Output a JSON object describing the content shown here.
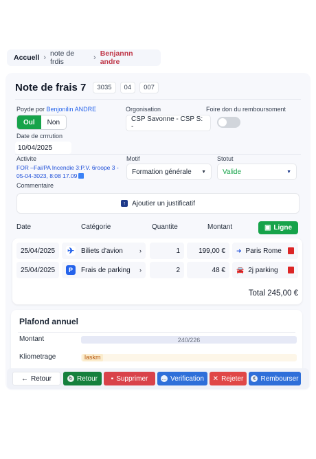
{
  "breadcrumb": {
    "home": "Accuell",
    "parent": "note de frdis",
    "current": "Benjannn andre",
    "separator": "›"
  },
  "header": {
    "title": "Note de frais 7",
    "chips": [
      "3035",
      "04",
      "007"
    ]
  },
  "form": {
    "paid_by": {
      "label_prefix": "Poyde por ",
      "label_name": "Benjonilin ANDRE",
      "yes": "Oul",
      "no": "Non"
    },
    "organisation": {
      "label": "Orgonisation",
      "value": "CSP Savonne - CSP S: -"
    },
    "refund": {
      "label": "Foire don du remboursoment"
    },
    "creation_date": {
      "label": "Date de crrrution",
      "value": "10/04/2025"
    },
    "activity": {
      "label": "Activite",
      "line1": "FOR –Fai/PA  Incendie 3:P.V. 6roope 3 -",
      "line2": "05-04-3023, 8:08 17.09"
    },
    "motif": {
      "label": "Motif",
      "value": "Formation générale"
    },
    "status": {
      "label": "Stotut",
      "value": "Valide"
    },
    "comment": {
      "label": "Commentaire"
    },
    "attach_label": "Ajoutier un justificatif"
  },
  "table": {
    "headers": {
      "date": "Date",
      "category": "Catégorie",
      "quantity": "Quantite",
      "amount": "Montant"
    },
    "add_label": "Ligne",
    "rows": [
      {
        "date": "25/04/2025",
        "category": "Biliets d'avion",
        "quantity": "1",
        "amount": "199,00 €",
        "detail": "Paris Rome",
        "detail_icon": "arrow-right-icon"
      },
      {
        "date": "25/04/2025",
        "category": "Frais de parking",
        "quantity": "2",
        "amount": "48 €",
        "detail": "2j parking",
        "detail_icon": "car-icon"
      }
    ],
    "total": "Total 245,00 €"
  },
  "plafond": {
    "title": "Plafond annuel",
    "amount_label": "Montant",
    "amount_value": "240/226",
    "km_label": "Kliometrage",
    "km_value": "laskm"
  },
  "actions": {
    "back": "Retour",
    "return": "Retour",
    "delete": "Supprimer",
    "verify": "Verification",
    "reject": "Rejeter",
    "refund": "Rembourser"
  }
}
